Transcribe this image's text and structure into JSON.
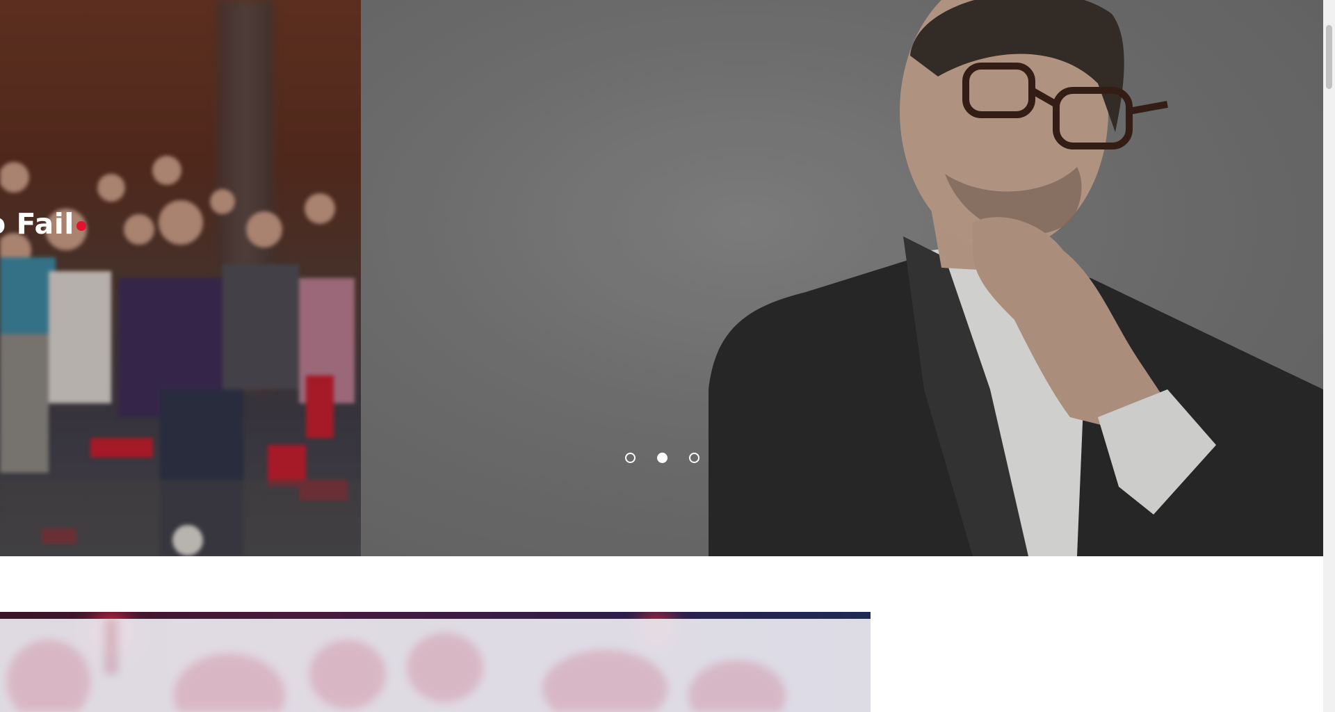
{
  "hero": {
    "heading_fragment": "o Fail",
    "slides": [
      {
        "label": "slide-1",
        "active": false
      },
      {
        "label": "slide-2",
        "active": true
      },
      {
        "label": "slide-3",
        "active": false
      }
    ],
    "accent_color": "#e0142c",
    "overlay_color": "rgba(0,0,0,0.12)"
  },
  "section2": {
    "overlay_color": "#eceaf0"
  },
  "icons": {
    "pager": "circle-dot"
  }
}
